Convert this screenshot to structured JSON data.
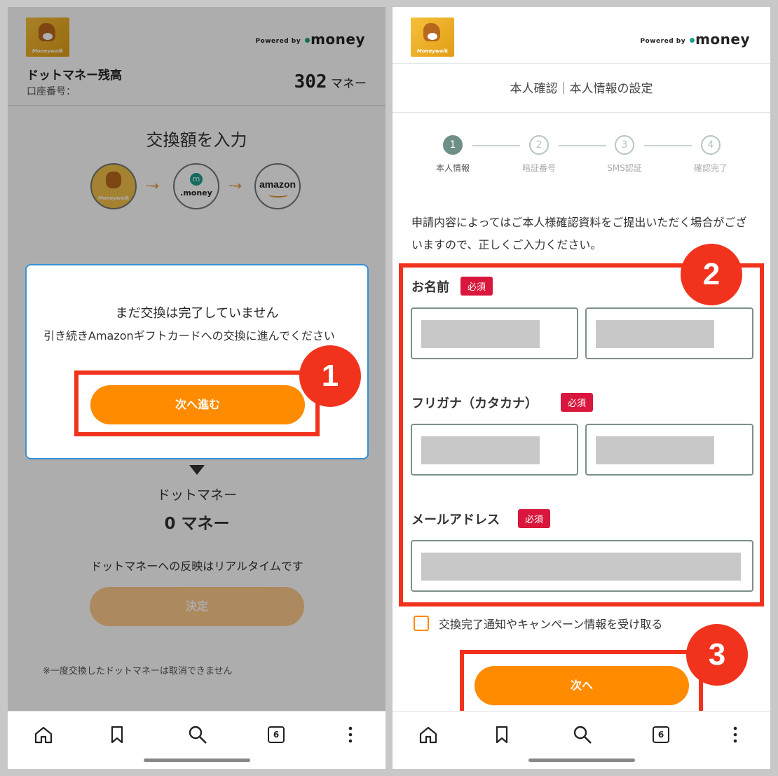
{
  "brand": {
    "logo_text": "Moneywalk",
    "powered_by": "Powered by",
    "money_word": "money"
  },
  "left": {
    "balance_title": "ドットマネー残高",
    "account_label": "口座番号：",
    "balance_value": "302",
    "balance_unit": "マネー",
    "page_title": "交換額を入力",
    "flow_icons": {
      "from": "Moneywalk",
      "via": ".money",
      "to": "amazon"
    },
    "dialog": {
      "title": "まだ交換は完了していません",
      "body": "引き続きAmazonギフトカードへの交換に進んでください",
      "button": "次へ進む"
    },
    "dotmoney_label": "ドットマネー",
    "dotmoney_value": "0 マネー",
    "realtime_note": "ドットマネーへの反映はリアルタイムです",
    "decide_button": "決定",
    "footnote": "※一度交換したドットマネーは取消できません",
    "badge": "1"
  },
  "right": {
    "subtitle": "本人確認｜本人情報の設定",
    "steps": [
      {
        "num": "1",
        "label": "本人情報",
        "active": true
      },
      {
        "num": "2",
        "label": "暗証番号",
        "active": false
      },
      {
        "num": "3",
        "label": "SMS認証",
        "active": false
      },
      {
        "num": "4",
        "label": "確認完了",
        "active": false
      }
    ],
    "notice": "申請内容によってはご本人様確認資料をご提出いただく場合がございますので、正しくご入力ください。",
    "fields": {
      "name_label": "お名前",
      "kana_label": "フリガナ（カタカナ）",
      "email_label": "メールアドレス",
      "required": "必須"
    },
    "checkbox_label": "交換完了通知やキャンペーン情報を受け取る",
    "next_button": "次へ",
    "badges": {
      "b2": "2",
      "b3": "3"
    }
  },
  "nav": {
    "tab_count": "6"
  },
  "colors": {
    "accent": "#ff8b00",
    "annotation": "#f1331d",
    "required": "#d9163c",
    "step_active": "#6d8f88"
  }
}
